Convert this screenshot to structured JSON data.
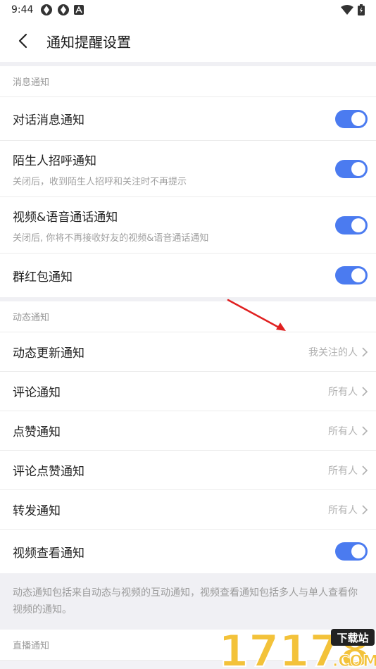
{
  "status": {
    "time": "9:44"
  },
  "header": {
    "title": "通知提醒设置"
  },
  "sections": [
    {
      "label": "消息通知",
      "items": [
        {
          "label": "对话消息通知",
          "desc": "",
          "control": "toggle",
          "on": true
        },
        {
          "label": "陌生人招呼通知",
          "desc": "关闭后，收到陌生人招呼和关注时不再提示",
          "control": "toggle",
          "on": true
        },
        {
          "label": "视频&语音通话通知",
          "desc": "关闭后, 你将不再接收好友的视频&语音通话通知",
          "control": "toggle",
          "on": true
        },
        {
          "label": "群红包通知",
          "desc": "",
          "control": "toggle",
          "on": true
        }
      ]
    },
    {
      "label": "动态通知",
      "items": [
        {
          "label": "动态更新通知",
          "value": "我关注的人"
        },
        {
          "label": "评论通知",
          "value": "所有人"
        },
        {
          "label": "点赞通知",
          "value": "所有人"
        },
        {
          "label": "评论点赞通知",
          "value": "所有人"
        },
        {
          "label": "转发通知",
          "value": "所有人"
        },
        {
          "label": "视频查看通知",
          "control": "toggle",
          "on": true
        }
      ]
    }
  ],
  "note": "动态通知包括来自动态与视频的互动通知，视频查看通知包括多人与单人查看你视频的通知。",
  "section3": {
    "label": "直播通知"
  },
  "watermark": {
    "text": "17178",
    "badge": "下载站",
    "domain": ".COM"
  },
  "colors": {
    "accent": "#4b7bf0",
    "annotation": "#e02020"
  }
}
